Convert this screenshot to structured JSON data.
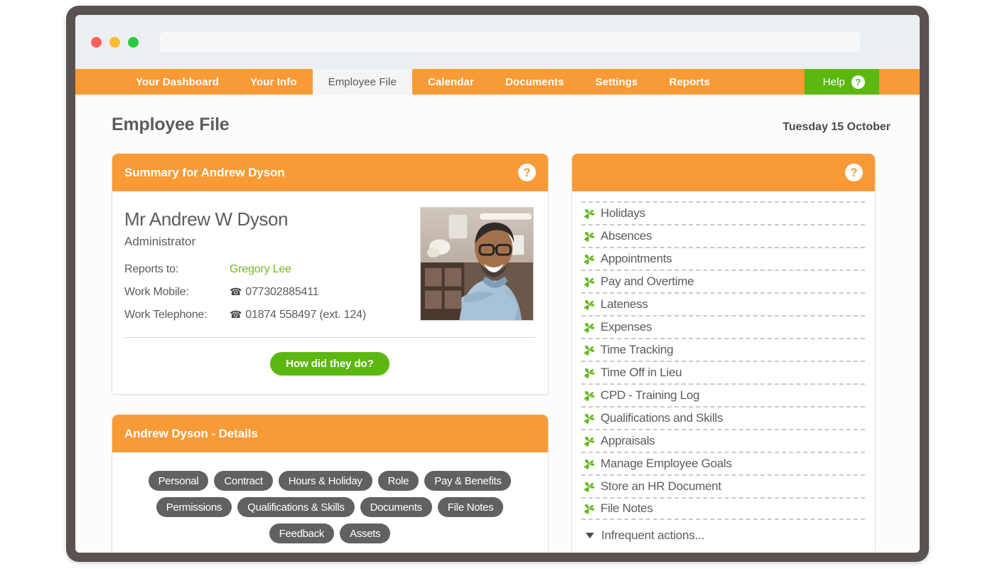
{
  "browser": {
    "traffic_lights": [
      "close",
      "minimize",
      "maximize"
    ],
    "address_value": "",
    "address_placeholder": ""
  },
  "nav": {
    "tabs": [
      {
        "label": "Your Dashboard",
        "active": false
      },
      {
        "label": "Your Info",
        "active": false
      },
      {
        "label": "Employee File",
        "active": true
      },
      {
        "label": "Calendar",
        "active": false
      },
      {
        "label": "Documents",
        "active": false
      },
      {
        "label": "Settings",
        "active": false
      },
      {
        "label": "Reports",
        "active": false
      }
    ],
    "help_label": "Help",
    "help_badge": "?"
  },
  "page": {
    "title": "Employee File",
    "date": "Tuesday 15 October"
  },
  "summary_card": {
    "title": "Summary for Andrew Dyson",
    "help_badge": "?",
    "employee_name": "Mr Andrew W Dyson",
    "employee_role": "Administrator",
    "details": [
      {
        "label": "Reports to:",
        "value": "Gregory Lee",
        "is_link": true,
        "has_phone_icon": false
      },
      {
        "label": "Work Mobile:",
        "value": "077302885411",
        "is_link": false,
        "has_phone_icon": true
      },
      {
        "label": "Work Telephone:",
        "value": "01874 558497 (ext. 124)",
        "is_link": false,
        "has_phone_icon": true
      }
    ],
    "action_button": "How did they do?",
    "photo_alt": "employee-portrait"
  },
  "details_card": {
    "title": "Andrew Dyson - Details",
    "pills": [
      "Personal",
      "Contract",
      "Hours & Holiday",
      "Role",
      "Pay & Benefits",
      "Permissions",
      "Qualifications & Skills",
      "Documents",
      "File Notes",
      "Feedback",
      "Assets"
    ]
  },
  "actions_card": {
    "title": "",
    "help_badge": "?",
    "items": [
      "Holidays",
      "Absences",
      "Appointments",
      "Pay and Overtime",
      "Lateness",
      "Expenses",
      "Time Tracking",
      "Time Off in Lieu",
      "CPD - Training Log",
      "Qualifications and Skills",
      "Appraisals",
      "Manage Employee Goals",
      "Store an HR Document",
      "File Notes"
    ],
    "infrequent_label": "Infrequent actions..."
  },
  "colors": {
    "orange": "#f89a35",
    "green": "#5cb811",
    "link_green": "#6fbb20",
    "pill_gray": "#616161",
    "frame": "#5a5250",
    "text": "#5c5c5c"
  }
}
